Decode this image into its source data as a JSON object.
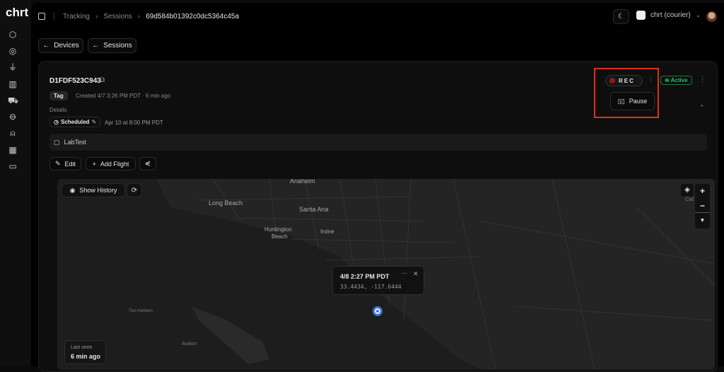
{
  "app": {
    "logo": "chrt"
  },
  "sidebar": {
    "items": [
      "packages-icon",
      "location-icon",
      "plug-icon",
      "analytics-icon",
      "truck-icon",
      "link-icon",
      "user-icon",
      "table-icon",
      "billing-icon"
    ]
  },
  "breadcrumb": [
    "Tracking",
    "Sessions",
    "69d584b01392c0dc5364c45a"
  ],
  "header": {
    "account": "chrt (courier)"
  },
  "nav": {
    "devices": "Devices",
    "sessions": "Sessions"
  },
  "device": {
    "id": "D1FDF523C943",
    "tag": "Tag",
    "created": "Created 4/7 3:26 PM PDT",
    "ago": "6 min ago",
    "details_label": "Details",
    "schedule_status": "Scheduled",
    "schedule_time": "Apr 10 at 8:00 PM PDT",
    "note": "LabTest"
  },
  "actions": {
    "edit": "Edit",
    "add_flight": "Add Flight"
  },
  "recording": {
    "rec": "REC",
    "pause": "Pause",
    "status": "Active",
    "accent": "#22c55e",
    "rec_color": "#8b1a1a",
    "highlight": "#e0301e"
  },
  "map": {
    "show_history": "Show History",
    "labels": [
      "Anaheim",
      "Long Beach",
      "Santa Ana",
      "Huntington",
      "Beach",
      "Irvine",
      "Two Harbors",
      "Avalon",
      "Cat"
    ],
    "popup": {
      "time": "4/8 2:27 PM PDT",
      "coords": "33.4434, -117.6444"
    },
    "last_seen_label": "Last seen",
    "last_seen": "6 min ago"
  }
}
